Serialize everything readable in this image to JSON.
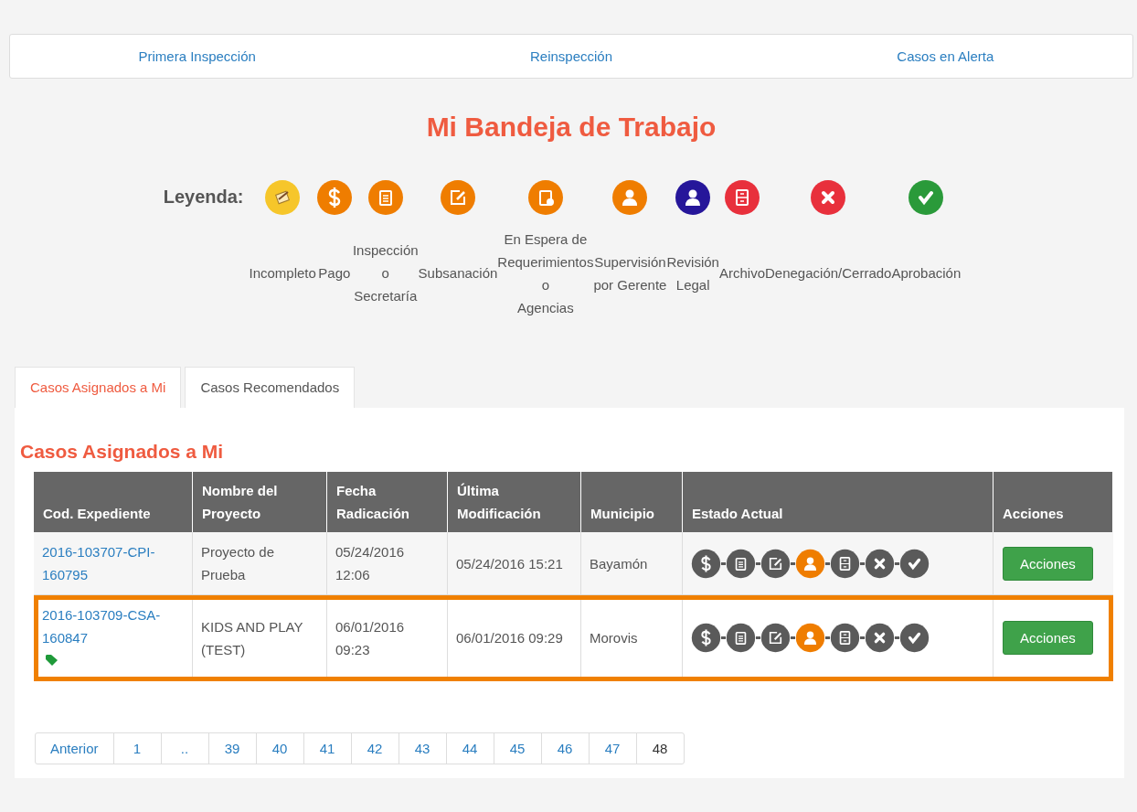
{
  "nav": [
    {
      "label": "Primera Inspección"
    },
    {
      "label": "Reinspección"
    },
    {
      "label": "Casos en Alerta"
    }
  ],
  "title": "Mi Bandeja de Trabajo",
  "legend": {
    "label": "Leyenda:",
    "items": [
      {
        "label": "Incompleto",
        "kind": "incomplete",
        "color": "#f6c62a"
      },
      {
        "label": "Pago",
        "kind": "dollar",
        "color": "#ef7d00"
      },
      {
        "label": "Inspección\no\nSecretaría",
        "kind": "clipboard",
        "color": "#ef7d00"
      },
      {
        "label": "Subsanación",
        "kind": "edit",
        "color": "#ef7d00"
      },
      {
        "label": "En Espera de\nRequerimientos\no\nAgencias",
        "kind": "clock",
        "color": "#ef7d00"
      },
      {
        "label": "Supervisión\npor Gerente",
        "kind": "person",
        "color": "#ef7d00"
      },
      {
        "label": "Revisión\nLegal",
        "kind": "person",
        "color": "#26169a"
      },
      {
        "label": "Archivo",
        "kind": "cabinet",
        "color": "#e8303c"
      },
      {
        "label": "Denegación/Cerrado",
        "kind": "x",
        "color": "#e8303c"
      },
      {
        "label": "Aprobación",
        "kind": "check",
        "color": "#2a9a3a"
      }
    ]
  },
  "tabs": [
    {
      "label": "Casos Asignados a Mi",
      "selected": true
    },
    {
      "label": "Casos Recomendados",
      "selected": false
    }
  ],
  "section_title": "Casos Asignados a Mi",
  "table": {
    "columns": [
      "Cod. Expediente",
      "Nombre del Proyecto",
      "Fecha Radicación",
      "Última Modificación",
      "Municipio",
      "Estado Actual",
      "Acciones"
    ],
    "rows": [
      {
        "code": "2016-103707-CPI-160795",
        "tagged": false,
        "project": "Proyecto de Prueba",
        "filed": "05/24/2016 12:06",
        "modified": "05/24/2016 15:21",
        "municipality": "Bayamón",
        "highlighted": false,
        "action": "Acciones",
        "steps": [
          {
            "kind": "dollar",
            "active": false
          },
          {
            "kind": "clipboard",
            "active": false
          },
          {
            "kind": "edit",
            "active": false
          },
          {
            "kind": "person",
            "active": true
          },
          {
            "kind": "cabinet",
            "active": false
          },
          {
            "kind": "x",
            "active": false
          },
          {
            "kind": "check",
            "active": false
          }
        ]
      },
      {
        "code": "2016-103709-CSA-160847",
        "tagged": true,
        "project": "KIDS AND PLAY (TEST)",
        "filed": "06/01/2016 09:23",
        "modified": "06/01/2016 09:29",
        "municipality": "Morovis",
        "highlighted": true,
        "action": "Acciones",
        "steps": [
          {
            "kind": "dollar",
            "active": false
          },
          {
            "kind": "clipboard",
            "active": false
          },
          {
            "kind": "edit",
            "active": false
          },
          {
            "kind": "person",
            "active": true
          },
          {
            "kind": "cabinet",
            "active": false
          },
          {
            "kind": "x",
            "active": false
          },
          {
            "kind": "check",
            "active": false
          }
        ]
      }
    ]
  },
  "pagination": [
    {
      "label": "Anterior",
      "selected": false
    },
    {
      "label": "1",
      "selected": false
    },
    {
      "label": "..",
      "selected": false
    },
    {
      "label": "39",
      "selected": false
    },
    {
      "label": "40",
      "selected": false
    },
    {
      "label": "41",
      "selected": false
    },
    {
      "label": "42",
      "selected": false
    },
    {
      "label": "43",
      "selected": false
    },
    {
      "label": "44",
      "selected": false
    },
    {
      "label": "45",
      "selected": false
    },
    {
      "label": "46",
      "selected": false
    },
    {
      "label": "47",
      "selected": false
    },
    {
      "label": "48",
      "selected": true
    }
  ]
}
